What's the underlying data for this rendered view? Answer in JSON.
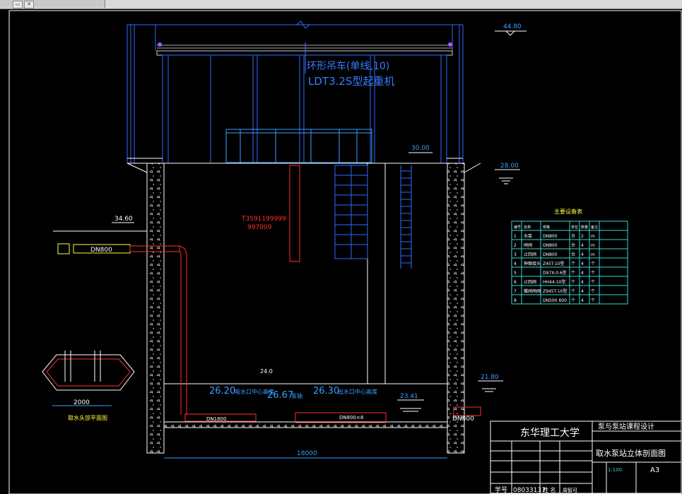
{
  "window": {
    "buttons": [
      "▭",
      "✕"
    ]
  },
  "drawing": {
    "title_block": {
      "university": "东华理工大学",
      "course": "泵与泵站课程设计",
      "drawing_title": "取水泵站立体剖面图",
      "scale": "1:100",
      "size": "A3",
      "student_no_label": "学号",
      "student_no": "08033137",
      "name_label": "姓 名",
      "row_label": "周智可"
    },
    "crane_label_1": "环形吊车(单线,10)",
    "crane_label_2": "LDT3.2S型起重机",
    "red_note_1": "T3591199999",
    "red_note_2": "997009",
    "elevations": {
      "top": "44.80",
      "left_inlet": "34.60",
      "mid": "30.00",
      "right": "28.00",
      "right_low": "21.80",
      "water": "23.41",
      "floor": "24.0"
    },
    "pipe_labels": {
      "dn800_inlet": "DN800",
      "dn800_outlet": "DN800",
      "suction_pipe": "DN1800",
      "discharge": "DN800×8"
    },
    "pipe_elevations": {
      "a": "26.20",
      "a_note": "吸水口中心高度",
      "b": "26.67",
      "b_note": "泵轴",
      "c": "26.30",
      "c_note": "出水口中心高度"
    },
    "dimension_bottom": "18000",
    "plan_caption": "取水头部平面图",
    "plan_dim": "2000",
    "equipment_table": {
      "title": "主要设备表",
      "headers": [
        "编号",
        "名称",
        "规格",
        "单位",
        "数量",
        "备注"
      ],
      "rows": [
        [
          "1",
          "水泵",
          "DN800",
          "台",
          "2",
          "m"
        ],
        [
          "2",
          "闸阀",
          "DN800",
          "台",
          "4",
          "m"
        ],
        [
          "3",
          "止回阀",
          "DN800",
          "台",
          "4",
          "m"
        ],
        [
          "4",
          "伸缩接头",
          "Z45T-10型",
          "个",
          "4",
          "个"
        ],
        [
          "5",
          "",
          "D97X-0.6型",
          "个",
          "4",
          "个"
        ],
        [
          "6",
          "止回阀",
          "HH44-10型",
          "个",
          "4",
          "个"
        ],
        [
          "7",
          "蝶阀闸阀",
          "Z945T-10型",
          "个",
          "4",
          "个"
        ],
        [
          "8",
          "",
          "DN500 600",
          "个",
          "4",
          "个"
        ]
      ]
    }
  }
}
